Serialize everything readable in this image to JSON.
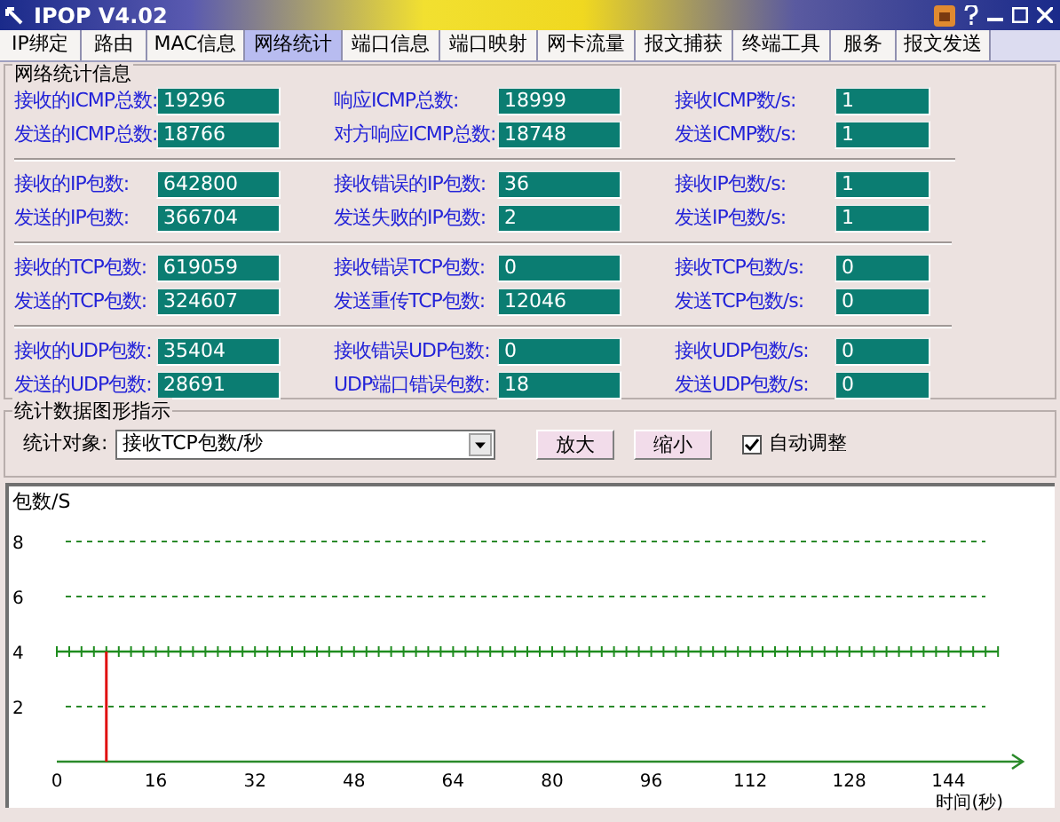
{
  "window": {
    "title": "IPOP V4.02"
  },
  "tabs": [
    {
      "label": "IP绑定",
      "selected": false
    },
    {
      "label": "路由",
      "selected": false
    },
    {
      "label": "MAC信息",
      "selected": false
    },
    {
      "label": "网络统计",
      "selected": true
    },
    {
      "label": "端口信息",
      "selected": false
    },
    {
      "label": "端口映射",
      "selected": false
    },
    {
      "label": "网卡流量",
      "selected": false
    },
    {
      "label": "报文捕获",
      "selected": false
    },
    {
      "label": "终端工具",
      "selected": false
    },
    {
      "label": "服务",
      "selected": false
    },
    {
      "label": "报文发送",
      "selected": false
    }
  ],
  "stats_group": {
    "title": "网络统计信息",
    "sections": [
      {
        "rows": [
          [
            {
              "label": "接收的ICMP总数:",
              "value": "19296"
            },
            {
              "label": "响应ICMP总数:",
              "value": "18999"
            },
            {
              "label": "接收ICMP数/s:",
              "value": "1"
            }
          ],
          [
            {
              "label": "发送的ICMP总数:",
              "value": "18766"
            },
            {
              "label": "对方响应ICMP总数:",
              "value": "18748"
            },
            {
              "label": "发送ICMP数/s:",
              "value": "1"
            }
          ]
        ]
      },
      {
        "rows": [
          [
            {
              "label": "接收的IP包数:",
              "value": "642800"
            },
            {
              "label": "接收错误的IP包数:",
              "value": "36"
            },
            {
              "label": "接收IP包数/s:",
              "value": "1"
            }
          ],
          [
            {
              "label": "发送的IP包数:",
              "value": "366704"
            },
            {
              "label": "发送失败的IP包数:",
              "value": "2"
            },
            {
              "label": "发送IP包数/s:",
              "value": "1"
            }
          ]
        ]
      },
      {
        "rows": [
          [
            {
              "label": "接收的TCP包数:",
              "value": "619059"
            },
            {
              "label": "接收错误TCP包数:",
              "value": "0"
            },
            {
              "label": "接收TCP包数/s:",
              "value": "0"
            }
          ],
          [
            {
              "label": "发送的TCP包数:",
              "value": "324607"
            },
            {
              "label": "发送重传TCP包数:",
              "value": "12046"
            },
            {
              "label": "发送TCP包数/s:",
              "value": "0"
            }
          ]
        ]
      },
      {
        "rows": [
          [
            {
              "label": "接收的UDP包数:",
              "value": "35404"
            },
            {
              "label": "接收错误UDP包数:",
              "value": "0"
            },
            {
              "label": "接收UDP包数/s:",
              "value": "0"
            }
          ],
          [
            {
              "label": "发送的UDP包数:",
              "value": "28691"
            },
            {
              "label": "UDP端口错误包数:",
              "value": "18"
            },
            {
              "label": "发送UDP包数/s:",
              "value": "0"
            }
          ]
        ]
      }
    ]
  },
  "graph_group": {
    "title": "统计数据图形指示",
    "object_label": "统计对象:",
    "object_value": "接收TCP包数/秒",
    "buttons": [
      "放大",
      "缩小"
    ],
    "auto_adjust": {
      "label": "自动调整",
      "checked": true
    }
  },
  "chart": {
    "chart_data": {
      "type": "line",
      "ylabel": "包数/S",
      "xlabel": "时间(秒)",
      "xlim": [
        0,
        156
      ],
      "ylim": [
        0,
        8
      ],
      "xticks": [
        0,
        16,
        32,
        48,
        64,
        80,
        96,
        112,
        128,
        144
      ],
      "yticks": [
        2,
        4,
        6,
        8
      ],
      "x": [
        0,
        2,
        4,
        6,
        8,
        10,
        12,
        14,
        16,
        18,
        20,
        22,
        24,
        26,
        28,
        30,
        32,
        34,
        36,
        38,
        40,
        42,
        44,
        46,
        48,
        50,
        52,
        54,
        56,
        58,
        60,
        62,
        64,
        66,
        68,
        70,
        72,
        74,
        76,
        78,
        80,
        82,
        84,
        86,
        88,
        90,
        92,
        94,
        96,
        98,
        100,
        102,
        104,
        106,
        108,
        110,
        112,
        114,
        116,
        118,
        120,
        122,
        124,
        126,
        128,
        130,
        132,
        134,
        136,
        138,
        140,
        142,
        144,
        146,
        148,
        150,
        152
      ],
      "series": [
        {
          "color": "#1e8c1e",
          "values": [
            4,
            4,
            4,
            4,
            4,
            4,
            4,
            4,
            4,
            4,
            4,
            4,
            4,
            4,
            4,
            4,
            4,
            4,
            4,
            4,
            4,
            4,
            4,
            4,
            4,
            4,
            4,
            4,
            4,
            4,
            4,
            4,
            4,
            4,
            4,
            4,
            4,
            4,
            4,
            4,
            4,
            4,
            4,
            4,
            4,
            4,
            4,
            4,
            4,
            4,
            4,
            4,
            4,
            4,
            4,
            4,
            4,
            4,
            4,
            4,
            4,
            4,
            4,
            4,
            4,
            4,
            4,
            4,
            4,
            4,
            4,
            4,
            4,
            4,
            4,
            4,
            4
          ]
        }
      ],
      "ref_lines": [
        {
          "axis": "y",
          "value": 2
        },
        {
          "axis": "y",
          "value": 6
        },
        {
          "axis": "y",
          "value": 8
        },
        {
          "axis": "x",
          "value": 8
        }
      ]
    }
  }
}
